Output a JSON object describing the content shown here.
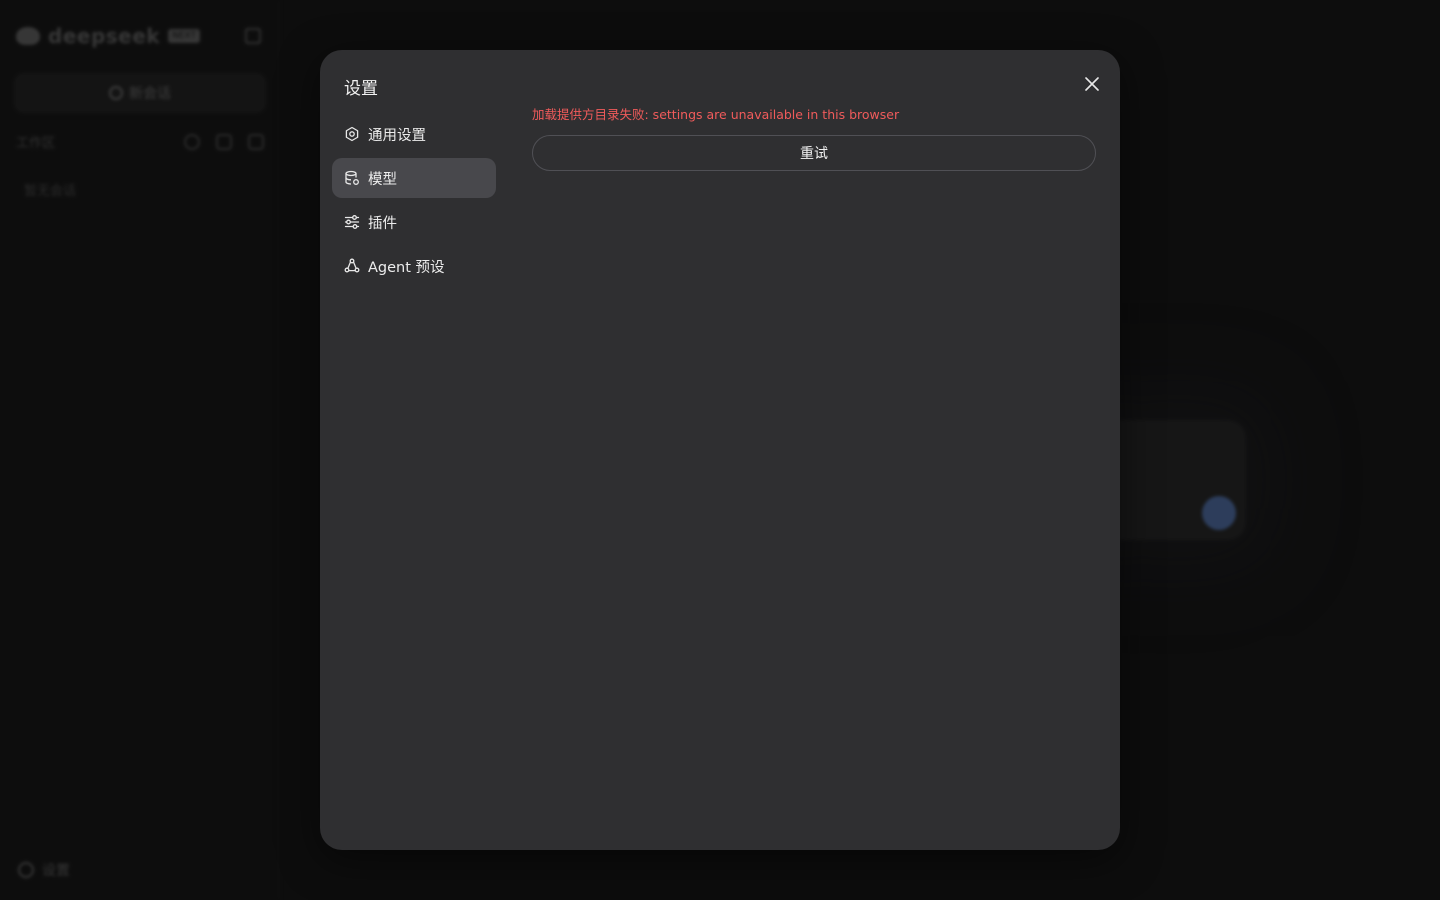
{
  "background": {
    "logo_text": "deepseek",
    "logo_badge": "NEXT",
    "new_chat_label": "新会话",
    "workspace_label": "工作区",
    "empty_text": "暂无会话",
    "settings_label": "设置"
  },
  "modal": {
    "title": "设置",
    "close_icon": "close-icon",
    "nav": [
      {
        "label": "通用设置",
        "icon": "gear-icon",
        "active": false
      },
      {
        "label": "模型",
        "icon": "database-icon",
        "active": true
      },
      {
        "label": "插件",
        "icon": "sliders-icon",
        "active": false
      },
      {
        "label": "Agent 预设",
        "icon": "agent-icon",
        "active": false
      }
    ],
    "error_text": "加载提供方目录失败: settings are unavailable in this browser",
    "retry_label": "重试"
  },
  "colors": {
    "error": "#f05b5b",
    "modal_bg": "#2f2f31",
    "active_nav": "#48484c",
    "accent_send": "#4e6ea8"
  }
}
